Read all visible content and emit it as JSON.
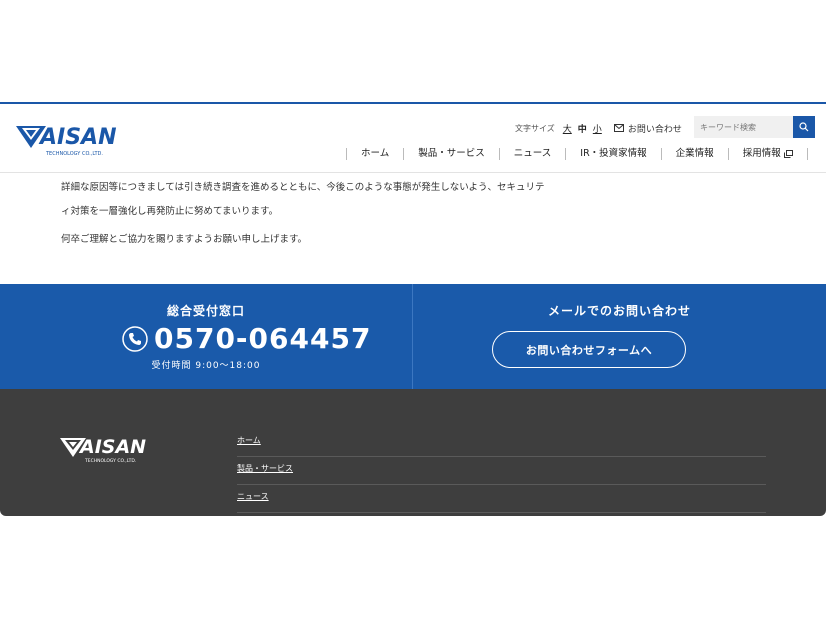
{
  "header": {
    "logo_main": "AISAN",
    "logo_sub": "TECHNOLOGY CO.,LTD.",
    "font_size_label": "文字サイズ",
    "font_size_options": [
      "大",
      "中",
      "小"
    ],
    "contact_label": "お問い合わせ",
    "search_placeholder": "キーワード検索",
    "nav": [
      "ホーム",
      "製品・サービス",
      "ニュース",
      "IR・投資家情報",
      "企業情報",
      "採用情報"
    ]
  },
  "article": {
    "paragraphs": [
      "詳細な原因等につきましては引き続き調査を進めるとともに、今後このような事態が発生しないよう、セキュリテ",
      "ィ対策を一層強化し再発防止に努めてまいります。",
      "何卒ご理解とご協力を賜りますようお願い申し上げます。"
    ]
  },
  "contact_band": {
    "phone_title": "総合受付窓口",
    "phone_number": "0570-064457",
    "hours": "受付時間 9:00〜18:00",
    "mail_title": "メールでのお問い合わせ",
    "form_button": "お問い合わせフォームへ"
  },
  "footer": {
    "logo_main": "AISAN",
    "logo_sub": "TECHNOLOGY CO.,LTD.",
    "links": [
      "ホーム",
      "製品・サービス",
      "ニュース"
    ]
  },
  "colors": {
    "brand_blue": "#1a5aaa",
    "footer_bg": "#3e3e3e"
  }
}
